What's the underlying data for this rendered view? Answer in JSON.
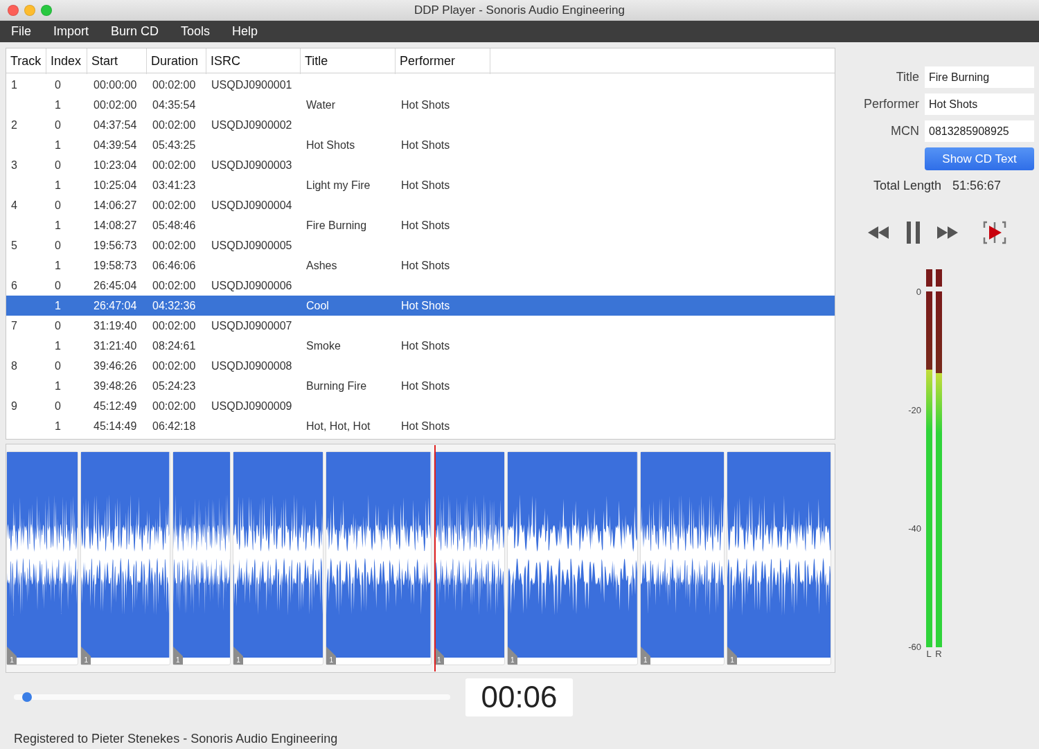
{
  "window": {
    "title": "DDP Player - Sonoris Audio Engineering"
  },
  "menu": [
    "File",
    "Import",
    "Burn CD",
    "Tools",
    "Help"
  ],
  "table": {
    "columns": [
      "Track",
      "Index",
      "Start",
      "Duration",
      "ISRC",
      "Title",
      "Performer"
    ],
    "rows": [
      {
        "track": "1",
        "index": "0",
        "start": "00:00:00",
        "duration": "00:02:00",
        "isrc": "USQDJ0900001",
        "selected": false
      },
      {
        "index": "1",
        "start": "00:02:00",
        "duration": "04:35:54",
        "title": "Water",
        "performer": "Hot Shots",
        "selected": false
      },
      {
        "track": "2",
        "index": "0",
        "start": "04:37:54",
        "duration": "00:02:00",
        "isrc": "USQDJ0900002",
        "selected": false
      },
      {
        "index": "1",
        "start": "04:39:54",
        "duration": "05:43:25",
        "title": "Hot Shots",
        "performer": "Hot Shots",
        "selected": false
      },
      {
        "track": "3",
        "index": "0",
        "start": "10:23:04",
        "duration": "00:02:00",
        "isrc": "USQDJ0900003",
        "selected": false
      },
      {
        "index": "1",
        "start": "10:25:04",
        "duration": "03:41:23",
        "title": "Light my Fire",
        "performer": "Hot Shots",
        "selected": false
      },
      {
        "track": "4",
        "index": "0",
        "start": "14:06:27",
        "duration": "00:02:00",
        "isrc": "USQDJ0900004",
        "selected": false
      },
      {
        "index": "1",
        "start": "14:08:27",
        "duration": "05:48:46",
        "title": "Fire Burning",
        "performer": "Hot Shots",
        "selected": false
      },
      {
        "track": "5",
        "index": "0",
        "start": "19:56:73",
        "duration": "00:02:00",
        "isrc": "USQDJ0900005",
        "selected": false
      },
      {
        "index": "1",
        "start": "19:58:73",
        "duration": "06:46:06",
        "title": "Ashes",
        "performer": "Hot Shots",
        "selected": false
      },
      {
        "track": "6",
        "index": "0",
        "start": "26:45:04",
        "duration": "00:02:00",
        "isrc": "USQDJ0900006",
        "selected": false
      },
      {
        "index": "1",
        "start": "26:47:04",
        "duration": "04:32:36",
        "title": "Cool",
        "performer": "Hot Shots",
        "selected": true
      },
      {
        "track": "7",
        "index": "0",
        "start": "31:19:40",
        "duration": "00:02:00",
        "isrc": "USQDJ0900007",
        "selected": false
      },
      {
        "index": "1",
        "start": "31:21:40",
        "duration": "08:24:61",
        "title": "Smoke",
        "performer": "Hot Shots",
        "selected": false
      },
      {
        "track": "8",
        "index": "0",
        "start": "39:46:26",
        "duration": "00:02:00",
        "isrc": "USQDJ0900008",
        "selected": false
      },
      {
        "index": "1",
        "start": "39:48:26",
        "duration": "05:24:23",
        "title": "Burning Fire",
        "performer": "Hot Shots",
        "selected": false
      },
      {
        "track": "9",
        "index": "0",
        "start": "45:12:49",
        "duration": "00:02:00",
        "isrc": "USQDJ0900009",
        "selected": false
      },
      {
        "index": "1",
        "start": "45:14:49",
        "duration": "06:42:18",
        "title": "Hot, Hot, Hot",
        "performer": "Hot Shots",
        "selected": false
      }
    ]
  },
  "waveform": {
    "markers": [
      "1",
      "1",
      "1",
      "1",
      "1",
      "1",
      "1",
      "1",
      "1"
    ]
  },
  "position_slider": {
    "level": 0.03
  },
  "time_display": "00:06",
  "cd_text": {
    "fields": [
      {
        "label": "Title",
        "value": "Fire Burning"
      },
      {
        "label": "Performer",
        "value": "Hot Shots"
      },
      {
        "label": "MCN",
        "value": "0813285908925"
      }
    ],
    "button": "Show CD Text",
    "total_length_label": "Total Length",
    "total_length": "51:56:67"
  },
  "meter": {
    "scale": [
      "0",
      "-20",
      "-40",
      "-60"
    ],
    "channels": [
      {
        "label": "L",
        "level": 0.78
      },
      {
        "label": "R",
        "level": 0.77
      }
    ]
  },
  "status": "Registered to Pieter Stenekes - Sonoris Audio Engineering"
}
